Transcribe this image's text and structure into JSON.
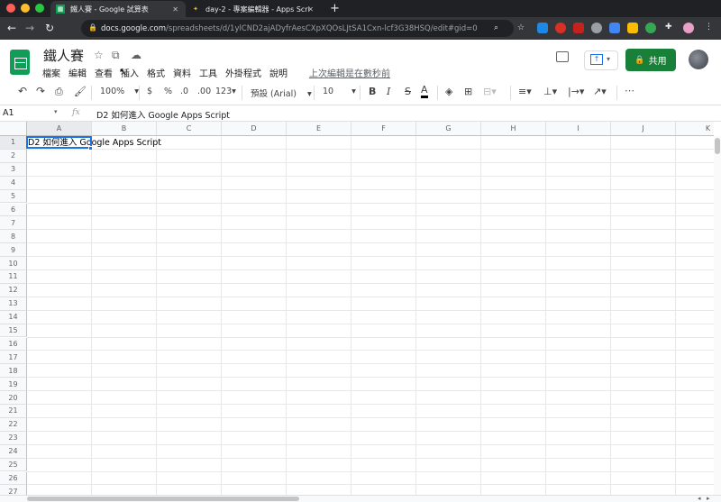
{
  "browser": {
    "tabs": [
      {
        "title": "鐵人賽 - Google 試算表",
        "active": true
      },
      {
        "title": "day-2 - 專案編輯器 - Apps Scri",
        "active": false
      }
    ],
    "url_host": "docs.google.com",
    "url_path": "/spreadsheets/d/1ylCND2ajADyfrAesCXpXQOsLJtSA1Cxn-lcf3G38HSQ/edit#gid=0",
    "new_tab": "+"
  },
  "sheet": {
    "title": "鐵人賽",
    "menu": [
      "檔案",
      "編輯",
      "查看",
      "插入",
      "格式",
      "資料",
      "工具",
      "外掛程式",
      "說明"
    ],
    "last_edit": "上次編輯是在數秒前",
    "share_label": "共用",
    "share_icon": "lock-icon"
  },
  "toolbar": {
    "zoom": "100%",
    "currency": "$",
    "percent": "%",
    "dec_decrease": ".0",
    "dec_increase": ".00",
    "more_formats": "123",
    "font": "預設 (Arial)",
    "font_size": "10",
    "bold": "B",
    "italic": "I",
    "strike": "S",
    "text_color": "A",
    "more": "⋯"
  },
  "formula_bar": {
    "name_box": "A1",
    "fx": "fx",
    "content": "D2 如何進入 Google Apps Script"
  },
  "grid": {
    "columns": [
      "A",
      "B",
      "C",
      "D",
      "E",
      "F",
      "G",
      "H",
      "I",
      "J",
      "K"
    ],
    "rows": [
      "1",
      "2",
      "3",
      "4",
      "5",
      "6",
      "7",
      "8",
      "9",
      "10",
      "11",
      "12",
      "13",
      "14",
      "15",
      "16",
      "17",
      "18",
      "19",
      "20",
      "21",
      "22",
      "23",
      "24",
      "25",
      "26",
      "27"
    ],
    "cell_a1": "D2 如何進入 Google Apps Script"
  },
  "colors": {
    "accent": "#1a73e8",
    "share_green": "#188038",
    "sheets_green": "#0f9d58"
  }
}
